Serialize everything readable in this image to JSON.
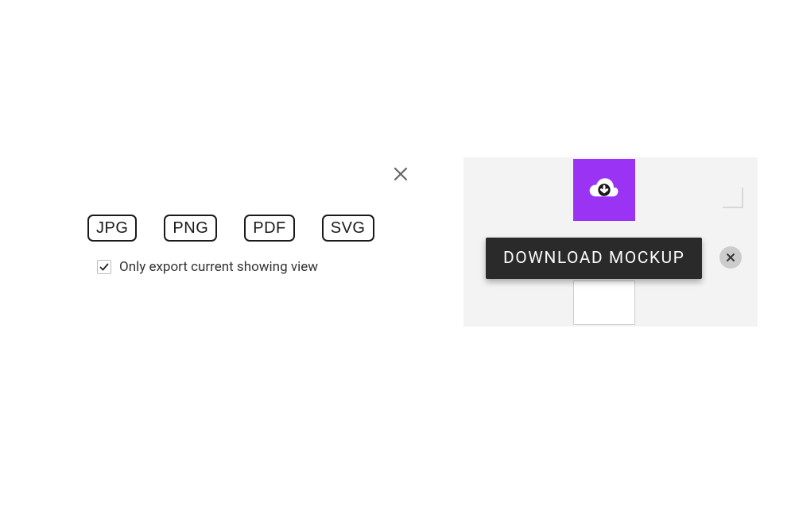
{
  "export": {
    "formats": [
      "JPG",
      "PNG",
      "PDF",
      "SVG"
    ],
    "checkbox": {
      "checked": true,
      "label": "Only export current showing view"
    }
  },
  "tooltip": {
    "text": "DOWNLOAD MOCKUP"
  },
  "colors": {
    "accent": "#9b33f5",
    "tooltip_bg": "#2a2a2a"
  }
}
